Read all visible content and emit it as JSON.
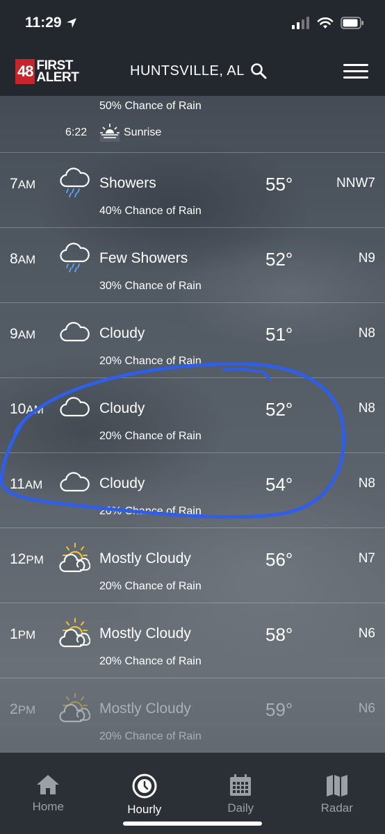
{
  "status_bar": {
    "time": "11:29"
  },
  "header": {
    "logo_number": "48",
    "logo_line1": "FIRST",
    "logo_line2": "ALERT",
    "location": "HUNTSVILLE, AL"
  },
  "partial": {
    "rain": "50% Chance of Rain",
    "sunrise_time": "6:22",
    "sunrise_label": "Sunrise"
  },
  "hourly": [
    {
      "hour": "7",
      "ampm": "AM",
      "icon": "showers-icon",
      "condition": "Showers",
      "temp": "55°",
      "wind": "NNW7",
      "rain": "40% Chance of Rain"
    },
    {
      "hour": "8",
      "ampm": "AM",
      "icon": "showers-icon",
      "condition": "Few Showers",
      "temp": "52°",
      "wind": "N9",
      "rain": "30% Chance of Rain"
    },
    {
      "hour": "9",
      "ampm": "AM",
      "icon": "cloud-icon",
      "condition": "Cloudy",
      "temp": "51°",
      "wind": "N8",
      "rain": "20% Chance of Rain"
    },
    {
      "hour": "10",
      "ampm": "AM",
      "icon": "cloud-icon",
      "condition": "Cloudy",
      "temp": "52°",
      "wind": "N8",
      "rain": "20% Chance of Rain"
    },
    {
      "hour": "11",
      "ampm": "AM",
      "icon": "cloud-icon",
      "condition": "Cloudy",
      "temp": "54°",
      "wind": "N8",
      "rain": "20% Chance of Rain"
    },
    {
      "hour": "12",
      "ampm": "PM",
      "icon": "partly-cloudy-icon",
      "condition": "Mostly Cloudy",
      "temp": "56°",
      "wind": "N7",
      "rain": "20% Chance of Rain"
    },
    {
      "hour": "1",
      "ampm": "PM",
      "icon": "partly-cloudy-icon",
      "condition": "Mostly Cloudy",
      "temp": "58°",
      "wind": "N6",
      "rain": "20% Chance of Rain"
    },
    {
      "hour": "2",
      "ampm": "PM",
      "icon": "partly-cloudy-icon",
      "condition": "Mostly Cloudy",
      "temp": "59°",
      "wind": "N6",
      "rain": "20% Chance of Rain"
    }
  ],
  "tabs": [
    {
      "label": "Home",
      "icon": "home-icon"
    },
    {
      "label": "Hourly",
      "icon": "clock-icon",
      "active": true
    },
    {
      "label": "Daily",
      "icon": "calendar-icon"
    },
    {
      "label": "Radar",
      "icon": "map-icon"
    }
  ],
  "colors": {
    "annotation": "#2f5ee8",
    "logo_red": "#c8242b"
  }
}
